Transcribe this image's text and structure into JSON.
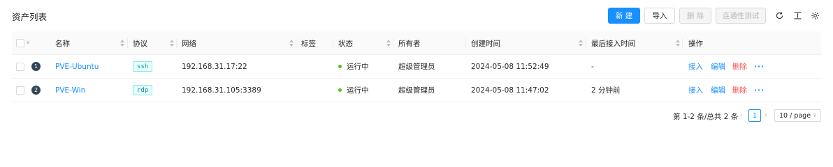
{
  "page": {
    "title": "资产列表"
  },
  "toolbar": {
    "new_label": "新 建",
    "import_label": "导入",
    "delete_label": "删 除",
    "test_label": "连通性测试",
    "icons": [
      "reload-icon",
      "column-height-icon",
      "setting-icon"
    ]
  },
  "colors": {
    "primary": "#1890ff",
    "danger": "#ff4d4f",
    "success": "#52c41a",
    "tag": "#08979c"
  },
  "table": {
    "columns": {
      "name": "名称",
      "protocol": "协议",
      "network": "网络",
      "tags": "标签",
      "status": "状态",
      "owner": "所有者",
      "created": "创建时间",
      "last_access": "最后接入时间",
      "actions": "操作"
    },
    "rows": [
      {
        "index": "1",
        "name": "PVE-Ubuntu",
        "protocol": "ssh",
        "network": "192.168.31.17:22",
        "tags": "",
        "status": "运行中",
        "owner": "超级管理员",
        "created": "2024-05-08 11:52:49",
        "last_access": "-",
        "action_connect": "接入",
        "action_edit": "编辑",
        "action_delete": "删除",
        "action_more": "···"
      },
      {
        "index": "2",
        "name": "PVE-Win",
        "protocol": "rdp",
        "network": "192.168.31.105:3389",
        "tags": "",
        "status": "运行中",
        "owner": "超级管理员",
        "created": "2024-05-08 11:47:02",
        "last_access": "2 分钟前",
        "action_connect": "接入",
        "action_edit": "编辑",
        "action_delete": "删除",
        "action_more": "···"
      }
    ]
  },
  "pagination": {
    "summary": "第 1-2 条/总共 2 条",
    "current_page": "1",
    "prev": "‹",
    "next": "›",
    "page_size": "10 / page"
  }
}
